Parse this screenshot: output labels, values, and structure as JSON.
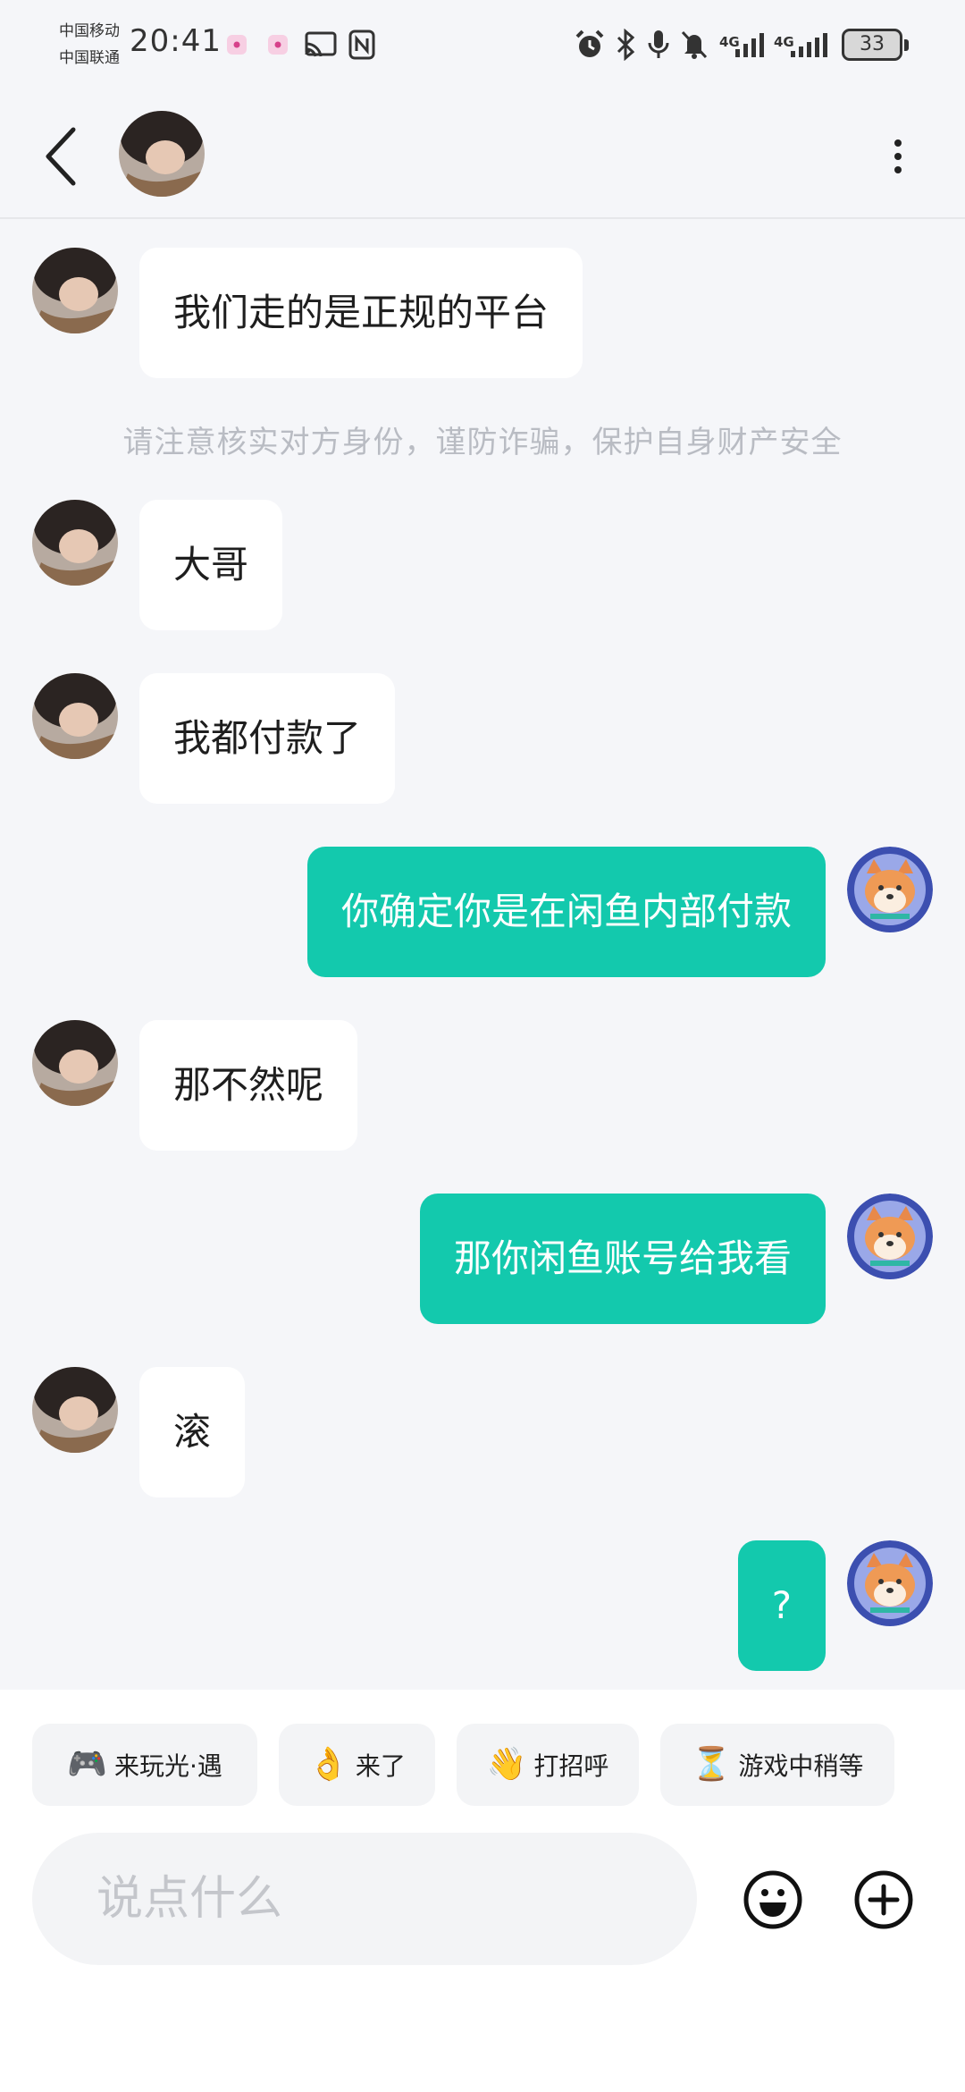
{
  "status_bar": {
    "carrier_1": "中国移动",
    "carrier_2": "中国联通",
    "time": "20:41",
    "network_1": "4G",
    "network_2": "4G",
    "battery": "33"
  },
  "header": {
    "back_icon": "chevron-left-icon",
    "more_icon": "more-vertical-icon"
  },
  "messages": [
    {
      "from": "them",
      "text": "我们走的是正规的平台"
    },
    {
      "from": "them",
      "text": "大哥"
    },
    {
      "from": "them",
      "text": "我都付款了"
    },
    {
      "from": "me",
      "text": "你确定你是在闲鱼内部付款"
    },
    {
      "from": "them",
      "text": "那不然呢"
    },
    {
      "from": "me",
      "text": "那你闲鱼账号给我看"
    },
    {
      "from": "them",
      "text": "滚"
    },
    {
      "from": "me",
      "text": "?"
    }
  ],
  "safety_notice": "请注意核实对方身份，谨防诈骗，保护自身财产安全",
  "quick_replies": [
    {
      "emoji": "🎮",
      "label": "来玩光·遇"
    },
    {
      "emoji": "👌",
      "label": "来了"
    },
    {
      "emoji": "👋",
      "label": "打招呼"
    },
    {
      "emoji": "⏳",
      "label": "游戏中稍等"
    }
  ],
  "input": {
    "placeholder": "说点什么"
  },
  "colors": {
    "accent": "#13c9ad",
    "background": "#f5f6f9"
  }
}
